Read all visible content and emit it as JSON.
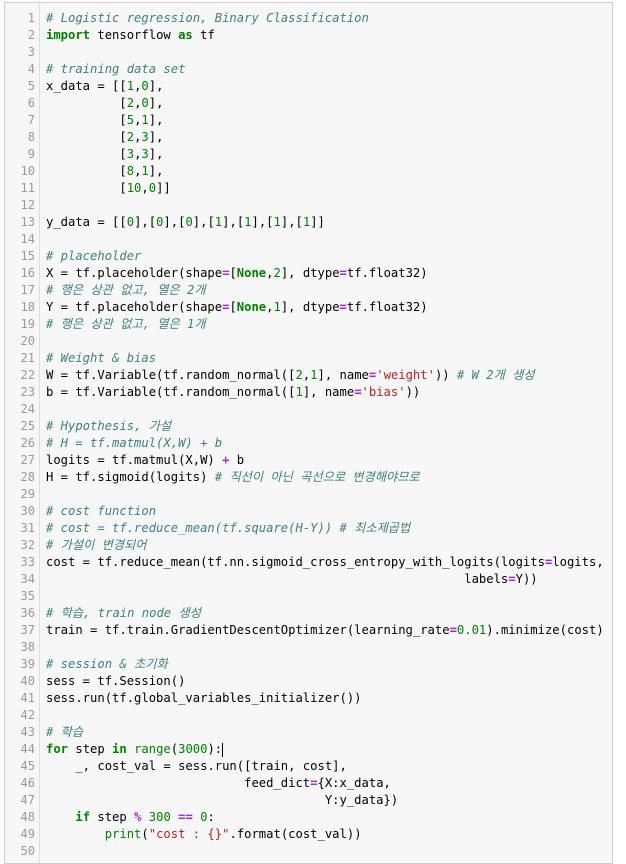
{
  "editor": {
    "lines": [
      {
        "n": "1",
        "tokens": [
          {
            "t": "c",
            "v": "# Logistic regression, Binary Classification"
          }
        ]
      },
      {
        "n": "2",
        "tokens": [
          {
            "t": "k",
            "v": "import"
          },
          {
            "t": "p",
            "v": " tensorflow "
          },
          {
            "t": "k",
            "v": "as"
          },
          {
            "t": "p",
            "v": " tf"
          }
        ]
      },
      {
        "n": "3",
        "tokens": []
      },
      {
        "n": "4",
        "tokens": [
          {
            "t": "c",
            "v": "# training data set"
          }
        ]
      },
      {
        "n": "5",
        "tokens": [
          {
            "t": "p",
            "v": "x_data = [["
          },
          {
            "t": "n",
            "v": "1"
          },
          {
            "t": "p",
            "v": ","
          },
          {
            "t": "n",
            "v": "0"
          },
          {
            "t": "p",
            "v": "],"
          }
        ]
      },
      {
        "n": "6",
        "tokens": [
          {
            "t": "p",
            "v": "          ["
          },
          {
            "t": "n",
            "v": "2"
          },
          {
            "t": "p",
            "v": ","
          },
          {
            "t": "n",
            "v": "0"
          },
          {
            "t": "p",
            "v": "],"
          }
        ]
      },
      {
        "n": "7",
        "tokens": [
          {
            "t": "p",
            "v": "          ["
          },
          {
            "t": "n",
            "v": "5"
          },
          {
            "t": "p",
            "v": ","
          },
          {
            "t": "n",
            "v": "1"
          },
          {
            "t": "p",
            "v": "],"
          }
        ]
      },
      {
        "n": "8",
        "tokens": [
          {
            "t": "p",
            "v": "          ["
          },
          {
            "t": "n",
            "v": "2"
          },
          {
            "t": "p",
            "v": ","
          },
          {
            "t": "n",
            "v": "3"
          },
          {
            "t": "p",
            "v": "],"
          }
        ]
      },
      {
        "n": "9",
        "tokens": [
          {
            "t": "p",
            "v": "          ["
          },
          {
            "t": "n",
            "v": "3"
          },
          {
            "t": "p",
            "v": ","
          },
          {
            "t": "n",
            "v": "3"
          },
          {
            "t": "p",
            "v": "],"
          }
        ]
      },
      {
        "n": "10",
        "tokens": [
          {
            "t": "p",
            "v": "          ["
          },
          {
            "t": "n",
            "v": "8"
          },
          {
            "t": "p",
            "v": ","
          },
          {
            "t": "n",
            "v": "1"
          },
          {
            "t": "p",
            "v": "],"
          }
        ]
      },
      {
        "n": "11",
        "tokens": [
          {
            "t": "p",
            "v": "          ["
          },
          {
            "t": "n",
            "v": "10"
          },
          {
            "t": "p",
            "v": ","
          },
          {
            "t": "n",
            "v": "0"
          },
          {
            "t": "p",
            "v": "]]"
          }
        ]
      },
      {
        "n": "12",
        "tokens": []
      },
      {
        "n": "13",
        "tokens": [
          {
            "t": "p",
            "v": "y_data = [["
          },
          {
            "t": "n",
            "v": "0"
          },
          {
            "t": "p",
            "v": "],["
          },
          {
            "t": "n",
            "v": "0"
          },
          {
            "t": "p",
            "v": "],["
          },
          {
            "t": "n",
            "v": "0"
          },
          {
            "t": "p",
            "v": "],["
          },
          {
            "t": "n",
            "v": "1"
          },
          {
            "t": "p",
            "v": "],["
          },
          {
            "t": "n",
            "v": "1"
          },
          {
            "t": "p",
            "v": "],["
          },
          {
            "t": "n",
            "v": "1"
          },
          {
            "t": "p",
            "v": "],["
          },
          {
            "t": "n",
            "v": "1"
          },
          {
            "t": "p",
            "v": "]]"
          }
        ]
      },
      {
        "n": "14",
        "tokens": []
      },
      {
        "n": "15",
        "tokens": [
          {
            "t": "c",
            "v": "# placeholder"
          }
        ]
      },
      {
        "n": "16",
        "tokens": [
          {
            "t": "p",
            "v": "X = tf.placeholder(shape"
          },
          {
            "t": "o",
            "v": "="
          },
          {
            "t": "p",
            "v": "["
          },
          {
            "t": "k",
            "v": "None"
          },
          {
            "t": "p",
            "v": ","
          },
          {
            "t": "n",
            "v": "2"
          },
          {
            "t": "p",
            "v": "], dtype"
          },
          {
            "t": "o",
            "v": "="
          },
          {
            "t": "p",
            "v": "tf.float32)"
          }
        ]
      },
      {
        "n": "17",
        "tokens": [
          {
            "t": "c",
            "v": "# 행은 상관 없고, 열은 2개"
          }
        ]
      },
      {
        "n": "18",
        "tokens": [
          {
            "t": "p",
            "v": "Y = tf.placeholder(shape"
          },
          {
            "t": "o",
            "v": "="
          },
          {
            "t": "p",
            "v": "["
          },
          {
            "t": "k",
            "v": "None"
          },
          {
            "t": "p",
            "v": ","
          },
          {
            "t": "n",
            "v": "1"
          },
          {
            "t": "p",
            "v": "], dtype"
          },
          {
            "t": "o",
            "v": "="
          },
          {
            "t": "p",
            "v": "tf.float32)"
          }
        ]
      },
      {
        "n": "19",
        "tokens": [
          {
            "t": "c",
            "v": "# 행은 상관 없고, 열은 1개"
          }
        ]
      },
      {
        "n": "20",
        "tokens": []
      },
      {
        "n": "21",
        "tokens": [
          {
            "t": "c",
            "v": "# Weight & bias"
          }
        ]
      },
      {
        "n": "22",
        "tokens": [
          {
            "t": "p",
            "v": "W = tf.Variable(tf.random_normal(["
          },
          {
            "t": "n",
            "v": "2"
          },
          {
            "t": "p",
            "v": ","
          },
          {
            "t": "n",
            "v": "1"
          },
          {
            "t": "p",
            "v": "], name"
          },
          {
            "t": "o",
            "v": "="
          },
          {
            "t": "s",
            "v": "'weight'"
          },
          {
            "t": "p",
            "v": ")) "
          },
          {
            "t": "c",
            "v": "# W 2개 생성"
          }
        ]
      },
      {
        "n": "23",
        "tokens": [
          {
            "t": "p",
            "v": "b = tf.Variable(tf.random_normal(["
          },
          {
            "t": "n",
            "v": "1"
          },
          {
            "t": "p",
            "v": "], name"
          },
          {
            "t": "o",
            "v": "="
          },
          {
            "t": "s",
            "v": "'bias'"
          },
          {
            "t": "p",
            "v": "))"
          }
        ]
      },
      {
        "n": "24",
        "tokens": []
      },
      {
        "n": "25",
        "tokens": [
          {
            "t": "c",
            "v": "# Hypothesis, 가설"
          }
        ]
      },
      {
        "n": "26",
        "tokens": [
          {
            "t": "c",
            "v": "# H = tf.matmul(X,W) + b"
          }
        ]
      },
      {
        "n": "27",
        "tokens": [
          {
            "t": "p",
            "v": "logits = tf.matmul(X,W) "
          },
          {
            "t": "o",
            "v": "+"
          },
          {
            "t": "p",
            "v": " b"
          }
        ]
      },
      {
        "n": "28",
        "tokens": [
          {
            "t": "p",
            "v": "H = tf.sigmoid(logits) "
          },
          {
            "t": "c",
            "v": "# 직선이 아닌 곡선으로 변경해야므로"
          }
        ]
      },
      {
        "n": "29",
        "tokens": []
      },
      {
        "n": "30",
        "tokens": [
          {
            "t": "c",
            "v": "# cost function"
          }
        ]
      },
      {
        "n": "31",
        "tokens": [
          {
            "t": "c",
            "v": "# cost = tf.reduce_mean(tf.square(H-Y)) # 최소제곱법"
          }
        ]
      },
      {
        "n": "32",
        "tokens": [
          {
            "t": "c",
            "v": "# 가설이 변경되어"
          }
        ]
      },
      {
        "n": "33",
        "tokens": [
          {
            "t": "p",
            "v": "cost = tf.reduce_mean(tf.nn.sigmoid_cross_entropy_with_logits(logits"
          },
          {
            "t": "o",
            "v": "="
          },
          {
            "t": "p",
            "v": "logits,"
          }
        ]
      },
      {
        "n": "34",
        "tokens": [
          {
            "t": "p",
            "v": "                                                         labels"
          },
          {
            "t": "o",
            "v": "="
          },
          {
            "t": "p",
            "v": "Y))"
          }
        ]
      },
      {
        "n": "35",
        "tokens": []
      },
      {
        "n": "36",
        "tokens": [
          {
            "t": "c",
            "v": "# 학습, train node 생성"
          }
        ]
      },
      {
        "n": "37",
        "tokens": [
          {
            "t": "p",
            "v": "train = tf.train.GradientDescentOptimizer(learning_rate"
          },
          {
            "t": "o",
            "v": "="
          },
          {
            "t": "n",
            "v": "0.01"
          },
          {
            "t": "p",
            "v": ").minimize(cost)"
          }
        ]
      },
      {
        "n": "38",
        "tokens": []
      },
      {
        "n": "39",
        "tokens": [
          {
            "t": "c",
            "v": "# session & 초기화"
          }
        ]
      },
      {
        "n": "40",
        "tokens": [
          {
            "t": "p",
            "v": "sess = tf.Session()"
          }
        ]
      },
      {
        "n": "41",
        "tokens": [
          {
            "t": "p",
            "v": "sess.run(tf.global_variables_initializer())"
          }
        ]
      },
      {
        "n": "42",
        "tokens": []
      },
      {
        "n": "43",
        "tokens": [
          {
            "t": "c",
            "v": "# 학습"
          }
        ]
      },
      {
        "n": "44",
        "tokens": [
          {
            "t": "k",
            "v": "for"
          },
          {
            "t": "p",
            "v": " step "
          },
          {
            "t": "k",
            "v": "in"
          },
          {
            "t": "p",
            "v": " "
          },
          {
            "t": "n",
            "v": "range"
          },
          {
            "t": "p",
            "v": "("
          },
          {
            "t": "n",
            "v": "3000"
          },
          {
            "t": "p",
            "v": "):"
          }
        ],
        "cursor": true
      },
      {
        "n": "45",
        "tokens": [
          {
            "t": "p",
            "v": "    _, cost_val = sess.run([train, cost],"
          }
        ]
      },
      {
        "n": "46",
        "tokens": [
          {
            "t": "p",
            "v": "                           feed_dict"
          },
          {
            "t": "o",
            "v": "="
          },
          {
            "t": "p",
            "v": "{X:x_data,"
          }
        ]
      },
      {
        "n": "47",
        "tokens": [
          {
            "t": "p",
            "v": "                                      Y:y_data})"
          }
        ]
      },
      {
        "n": "48",
        "tokens": [
          {
            "t": "p",
            "v": "    "
          },
          {
            "t": "k",
            "v": "if"
          },
          {
            "t": "p",
            "v": " step "
          },
          {
            "t": "o",
            "v": "%"
          },
          {
            "t": "p",
            "v": " "
          },
          {
            "t": "n",
            "v": "300"
          },
          {
            "t": "p",
            "v": " "
          },
          {
            "t": "o",
            "v": "=="
          },
          {
            "t": "p",
            "v": " "
          },
          {
            "t": "n",
            "v": "0"
          },
          {
            "t": "p",
            "v": ":"
          }
        ]
      },
      {
        "n": "49",
        "tokens": [
          {
            "t": "p",
            "v": "        "
          },
          {
            "t": "n",
            "v": "print"
          },
          {
            "t": "p",
            "v": "("
          },
          {
            "t": "s",
            "v": "\"cost : {}\""
          },
          {
            "t": "p",
            "v": ".format(cost_val))"
          }
        ]
      },
      {
        "n": "50",
        "tokens": []
      }
    ]
  },
  "colors": {
    "comment": "#408080",
    "keyword": "#008000",
    "string": "#ba2121",
    "number": "#008000",
    "operator": "#aa22ff"
  }
}
